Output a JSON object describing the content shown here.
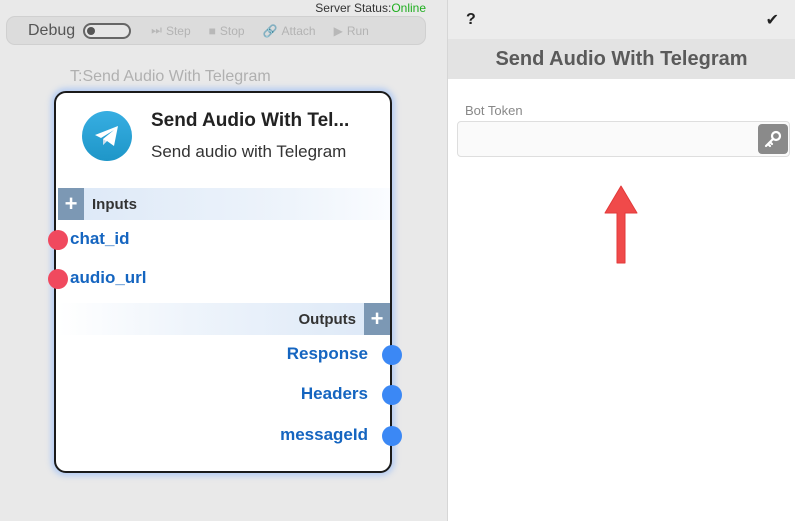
{
  "server_status": {
    "label": "Server Status:",
    "value": "Online",
    "color": "#1fae1f"
  },
  "toolbar": {
    "debug_label": "Debug",
    "step": "Step",
    "stop": "Stop",
    "attach": "Attach",
    "run": "Run"
  },
  "node": {
    "caption": "T:Send Audio With Telegram",
    "title": "Send Audio With Tel...",
    "subtitle": "Send audio with Telegram",
    "inputs_label": "Inputs",
    "outputs_label": "Outputs",
    "inputs": [
      "chat_id",
      "audio_url"
    ],
    "outputs": [
      "Response",
      "Headers",
      "messageId"
    ],
    "plus": "+"
  },
  "panel": {
    "help": "?",
    "confirm": "✔",
    "title": "Send Audio With Telegram",
    "bot_token_label": "Bot Token",
    "bot_token_value": ""
  },
  "colors": {
    "input_port": "#f0495e",
    "output_port": "#3b88f5",
    "port_text": "#1565c0",
    "arrow": "#f04a4a"
  },
  "icons": {
    "logo": "telegram-icon",
    "step": "step-icon",
    "stop": "stop-icon",
    "attach": "link-icon",
    "run": "play-icon",
    "key": "key-icon",
    "annotation": "red-up-arrow"
  }
}
